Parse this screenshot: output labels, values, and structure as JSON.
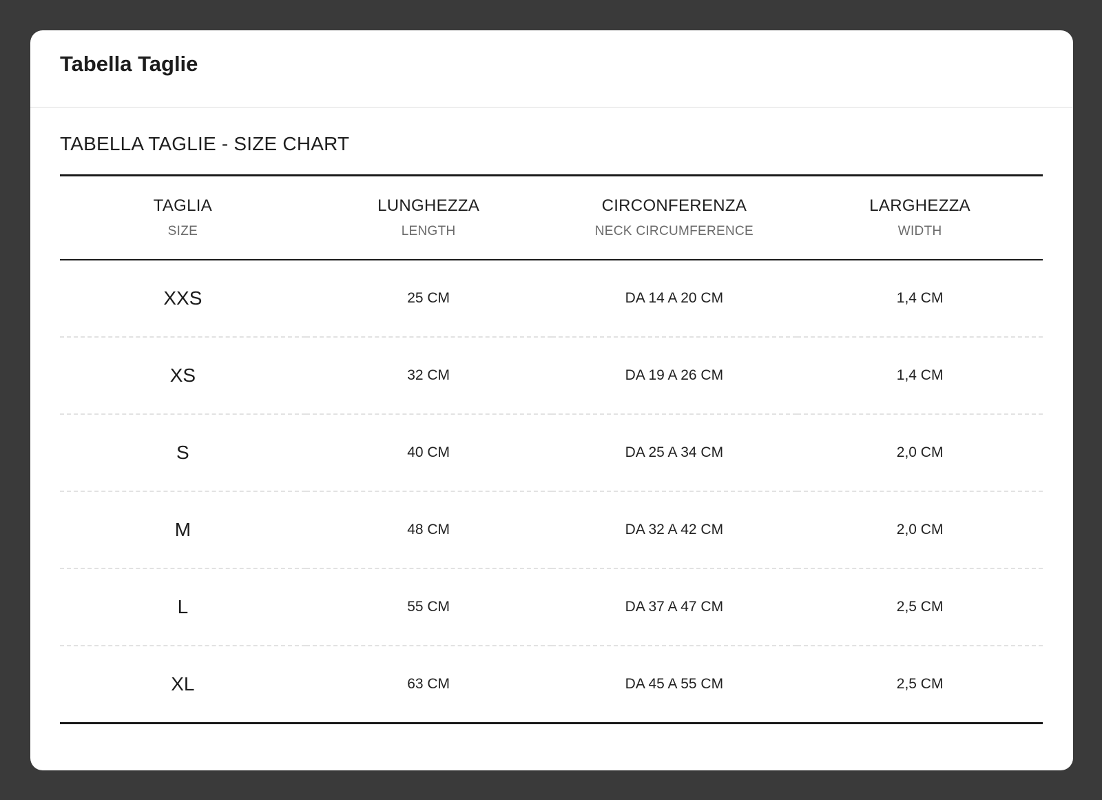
{
  "modal": {
    "title": "Tabella Taglie"
  },
  "chart": {
    "heading": "TABELLA TAGLIE - SIZE CHART",
    "columns": [
      {
        "main": "TAGLIA",
        "sub": "SIZE"
      },
      {
        "main": "LUNGHEZZA",
        "sub": "LENGTH"
      },
      {
        "main": "CIRCONFERENZA",
        "sub": "NECK CIRCUMFERENCE"
      },
      {
        "main": "LARGHEZZA",
        "sub": "WIDTH"
      }
    ],
    "rows": [
      [
        "XXS",
        "25 CM",
        "DA 14 A 20 CM",
        "1,4 CM"
      ],
      [
        "XS",
        "32 CM",
        "DA 19 A 26 CM",
        "1,4 CM"
      ],
      [
        "S",
        "40 CM",
        "DA 25 A 34 CM",
        "2,0 CM"
      ],
      [
        "M",
        "48 CM",
        "DA 32 A 42 CM",
        "2,0 CM"
      ],
      [
        "L",
        "55 CM",
        "DA 37 A 47 CM",
        "2,5 CM"
      ],
      [
        "XL",
        "63 CM",
        "DA 45 A 55 CM",
        "2,5 CM"
      ]
    ]
  },
  "colors": {
    "backdrop": "#3a3a3a",
    "panel": "#ffffff",
    "rule": "#1a1a1a",
    "muted_text": "#6b6b6b"
  }
}
